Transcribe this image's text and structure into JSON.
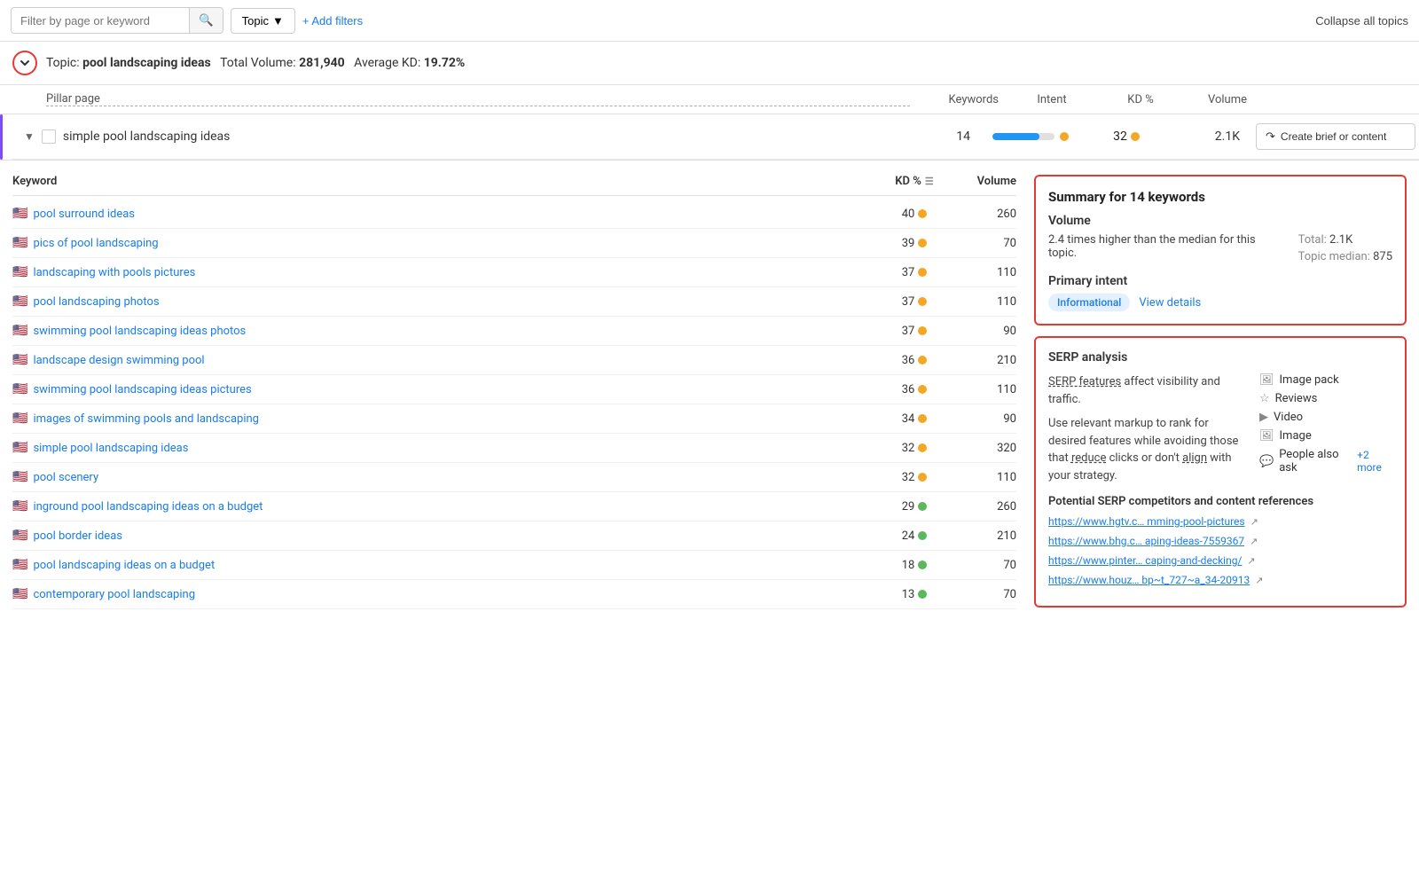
{
  "toolbar": {
    "filter_placeholder": "Filter by page or keyword",
    "topic_label": "Topic",
    "add_filters_label": "+ Add filters",
    "collapse_all_label": "Collapse all topics"
  },
  "topic": {
    "name": "pool landscaping ideas",
    "total_volume_label": "Total Volume:",
    "total_volume": "281,940",
    "avg_kd_label": "Average KD:",
    "avg_kd": "19.72%"
  },
  "columns": {
    "pillar_page": "Pillar page",
    "keywords": "Keywords",
    "intent": "Intent",
    "kd_pct": "KD %",
    "volume": "Volume"
  },
  "pillar_row": {
    "title": "simple pool landscaping ideas",
    "keywords": "14",
    "kd": "32",
    "volume": "2.1K",
    "create_btn": "Create brief or content",
    "intent_blue_pct": 75,
    "intent_yellow_pct": 25
  },
  "keyword_table": {
    "col_keyword": "Keyword",
    "col_kd": "KD %",
    "col_volume": "Volume",
    "rows": [
      {
        "flag": "🇺🇸",
        "name": "pool surround ideas",
        "kd": "40",
        "dot": "yellow",
        "volume": "260"
      },
      {
        "flag": "🇺🇸",
        "name": "pics of pool landscaping",
        "kd": "39",
        "dot": "yellow",
        "volume": "70"
      },
      {
        "flag": "🇺🇸",
        "name": "landscaping with pools pictures",
        "kd": "37",
        "dot": "yellow",
        "volume": "110"
      },
      {
        "flag": "🇺🇸",
        "name": "pool landscaping photos",
        "kd": "37",
        "dot": "yellow",
        "volume": "110"
      },
      {
        "flag": "🇺🇸",
        "name": "swimming pool landscaping ideas photos",
        "kd": "37",
        "dot": "yellow",
        "volume": "90"
      },
      {
        "flag": "🇺🇸",
        "name": "landscape design swimming pool",
        "kd": "36",
        "dot": "yellow",
        "volume": "210"
      },
      {
        "flag": "🇺🇸",
        "name": "swimming pool landscaping ideas pictures",
        "kd": "36",
        "dot": "yellow",
        "volume": "110"
      },
      {
        "flag": "🇺🇸",
        "name": "images of swimming pools and landscaping",
        "kd": "34",
        "dot": "yellow",
        "volume": "90"
      },
      {
        "flag": "🇺🇸",
        "name": "simple pool landscaping ideas",
        "kd": "32",
        "dot": "yellow",
        "volume": "320"
      },
      {
        "flag": "🇺🇸",
        "name": "pool scenery",
        "kd": "32",
        "dot": "yellow",
        "volume": "110"
      },
      {
        "flag": "🇺🇸",
        "name": "inground pool landscaping ideas on a budget",
        "kd": "29",
        "dot": "green",
        "volume": "260"
      },
      {
        "flag": "🇺🇸",
        "name": "pool border ideas",
        "kd": "24",
        "dot": "green",
        "volume": "210"
      },
      {
        "flag": "🇺🇸",
        "name": "pool landscaping ideas on a budget",
        "kd": "18",
        "dot": "green",
        "volume": "70"
      },
      {
        "flag": "🇺🇸",
        "name": "contemporary pool landscaping",
        "kd": "13",
        "dot": "green",
        "volume": "70"
      }
    ]
  },
  "summary": {
    "title": "Summary for 14 keywords",
    "volume_label": "Volume",
    "volume_desc": "2.4 times higher than the median for this topic.",
    "total_label": "Total:",
    "total_value": "2.1K",
    "median_label": "Topic median:",
    "median_value": "875",
    "primary_intent_label": "Primary intent",
    "intent_badge": "Informational",
    "view_details": "View details"
  },
  "serp": {
    "title": "SERP analysis",
    "features_label": "SERP features",
    "description1": "affect visibility and traffic.",
    "description2": "Use relevant markup to rank for desired features while avoiding those that",
    "reduce_label": "reduce",
    "clicks_text": "clicks or don't",
    "align_label": "align",
    "with_strategy": "with your strategy.",
    "features": [
      {
        "icon": "🖼",
        "label": "Image pack"
      },
      {
        "icon": "☆",
        "label": "Reviews"
      },
      {
        "icon": "▶",
        "label": "Video"
      },
      {
        "icon": "🖼",
        "label": "Image"
      },
      {
        "icon": "💬",
        "label": "People also ask",
        "extra": "+2 more"
      }
    ],
    "competitors_title": "Potential SERP competitors and content references",
    "urls": [
      "https://www.hgtv.c… mming-pool-pictures",
      "https://www.bhg.c… aping-ideas-7559367",
      "https://www.pinter… caping-and-decking/",
      "https://www.houz… bp~t_727~a_34-20913"
    ]
  }
}
